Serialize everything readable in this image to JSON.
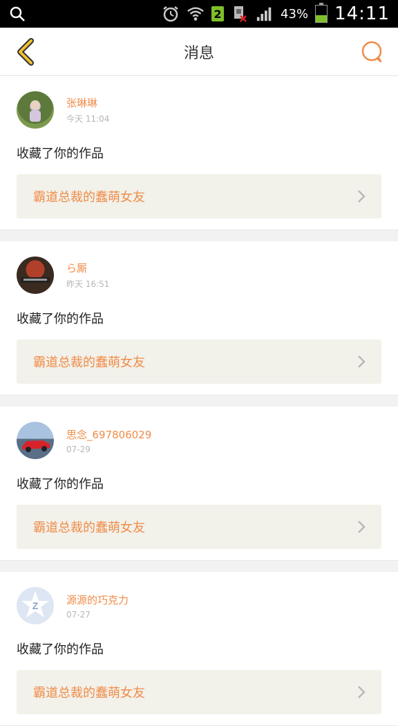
{
  "statusbar": {
    "sim_badge": "2",
    "battery_percent": "43%",
    "battery_level": 0.43,
    "time": "14:11"
  },
  "header": {
    "title": "消息"
  },
  "messages": [
    {
      "username": "张琳琳",
      "time": "今天 11:04",
      "action": "收藏了你的作品",
      "work_title": "霸道总裁的蠢萌女友",
      "avatar_icon": "photo-avatar-icon"
    },
    {
      "username": "ら厮",
      "time": "昨天 16:51",
      "action": "收藏了你的作品",
      "work_title": "霸道总裁的蠢萌女友",
      "avatar_icon": "photo-avatar-icon"
    },
    {
      "username": "思念_697806029",
      "time": "07-29",
      "action": "收藏了你的作品",
      "work_title": "霸道总裁的蠢萌女友",
      "avatar_icon": "car-avatar-icon"
    },
    {
      "username": "源源的巧克力",
      "time": "07-27",
      "action": "收藏了你的作品",
      "work_title": "霸道总裁的蠢萌女友",
      "avatar_icon": "default-avatar-icon"
    }
  ],
  "colors": {
    "accent": "#f08c48",
    "back_arrow": "#f0c030",
    "link_bg": "#f2f1ea"
  }
}
